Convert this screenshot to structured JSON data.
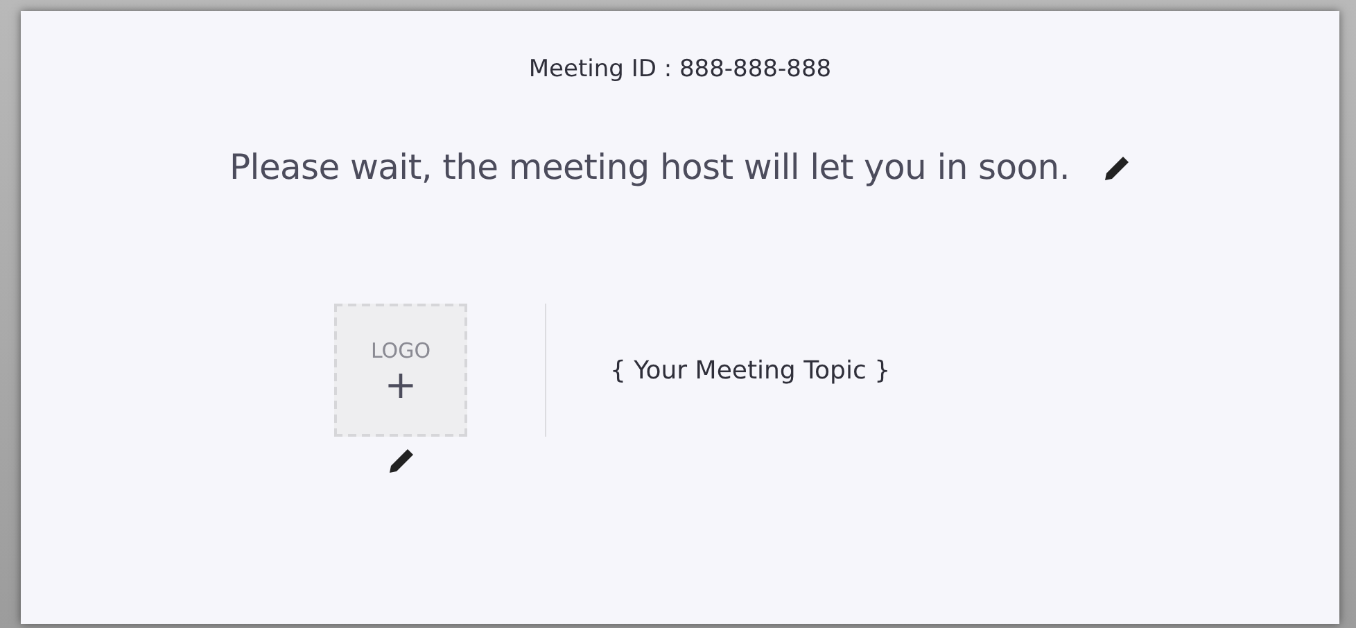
{
  "meeting_id": "Meeting ID : 888-888-888",
  "message": "Please wait, the meeting host will let you in soon.",
  "logo": {
    "label": "LOGO",
    "add": "+"
  },
  "topic": "{ Your Meeting Topic }"
}
